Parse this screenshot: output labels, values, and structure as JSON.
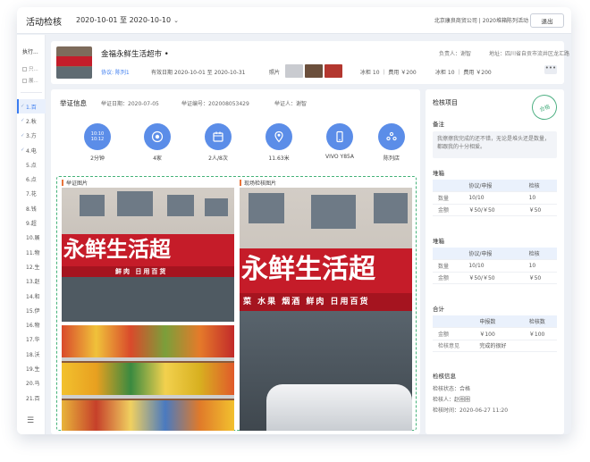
{
  "topbar": {
    "title": "活动检核",
    "date_range": "2020-10-01 至 2020-10-10",
    "company": "北京康良商贸公司 | 2020堆箱陈列活动",
    "exit_label": "退出"
  },
  "sidebar": {
    "header": "执行...",
    "options": [
      "只...",
      "展..."
    ],
    "stores": [
      {
        "label": "1.百",
        "checked": true,
        "active": true
      },
      {
        "label": "2.秋",
        "checked": true
      },
      {
        "label": "3.方",
        "checked": true
      },
      {
        "label": "4.电",
        "checked": true
      },
      {
        "label": "5.点"
      },
      {
        "label": "6.点"
      },
      {
        "label": "7.花"
      },
      {
        "label": "8.钱"
      },
      {
        "label": "9.超"
      },
      {
        "label": "10.展"
      },
      {
        "label": "11.物"
      },
      {
        "label": "12.生"
      },
      {
        "label": "13.赵"
      },
      {
        "label": "14.和"
      },
      {
        "label": "15.伊"
      },
      {
        "label": "16.物"
      },
      {
        "label": "17.华"
      },
      {
        "label": "18.沃"
      },
      {
        "label": "19.生"
      },
      {
        "label": "20.马"
      },
      {
        "label": "21.百"
      }
    ]
  },
  "store_card": {
    "name": "金福永鲜生活超市 •",
    "responsible": "负责人：谢智",
    "address": "地址：四川省自贡市流井区龙汇路",
    "protocol": "协议: 陈列1",
    "period": "有效日期 2020-10-01 至 2020-10-31",
    "photo_label": "照片",
    "freezer1": "冰柜 10 ｜ 费用 ￥200",
    "freezer2": "冰柜 10 ｜ 费用 ￥200",
    "more": "•••"
  },
  "verification": {
    "title": "举证信息",
    "date": "举证日期：2020-07-05",
    "number": "举证编号：202008053429",
    "person": "举证人：谢智",
    "metrics": [
      {
        "icon": "clock-icon",
        "line1": "10:10",
        "line2": "10:12",
        "value": "2分钟"
      },
      {
        "icon": "camera-lens-icon",
        "value": "4家"
      },
      {
        "icon": "calendar-icon",
        "value": "2人/8次"
      },
      {
        "icon": "location-pin-icon",
        "value": "11.63米"
      },
      {
        "icon": "phone-icon",
        "value": "VIVO Y85A"
      },
      {
        "icon": "store-icon",
        "value": "陈列店"
      }
    ],
    "evidence_label": "举证图片",
    "onsite_label": "现场检核图片",
    "sign_text": "永鲜生活超",
    "sign_sub": "鲜肉 日用百货",
    "sign_text2": "永鲜生活超",
    "sign_sub2": "菜 水果 烟酒 鲜肉 日用百货"
  },
  "check": {
    "title": "检核项目",
    "stamp": "合格",
    "remark_label": "备注",
    "remark_text": "我擦擦我完成的还不错，无论是堆头还是数量，都跟我的十分相爱。",
    "sections": [
      {
        "title": "堆箱",
        "headers": [
          "",
          "协议/申报",
          "检核"
        ],
        "rows": [
          [
            "数量",
            "10/10",
            "10"
          ],
          [
            "金额",
            "￥50/￥50",
            "￥50"
          ]
        ]
      },
      {
        "title": "堆箱",
        "headers": [
          "",
          "协议/申报",
          "检核"
        ],
        "rows": [
          [
            "数量",
            "10/10",
            "10"
          ],
          [
            "金额",
            "￥50/￥50",
            "￥50"
          ]
        ]
      },
      {
        "title": "合计",
        "headers": [
          "",
          "申报数",
          "检核数"
        ],
        "rows": [
          [
            "金额",
            "￥100",
            "￥100"
          ],
          [
            "检核意见",
            "完成的很好",
            ""
          ]
        ]
      }
    ],
    "info_title": "检核信息",
    "status": "检核状态：合格",
    "checker": "检核人：赵圈圈",
    "time": "检核时间：2020-06-27 11:20"
  },
  "colors": {
    "accent": "#3b7cf0",
    "metric": "#5b8de8",
    "pass": "#4eb083",
    "sign": "#c51c29"
  }
}
